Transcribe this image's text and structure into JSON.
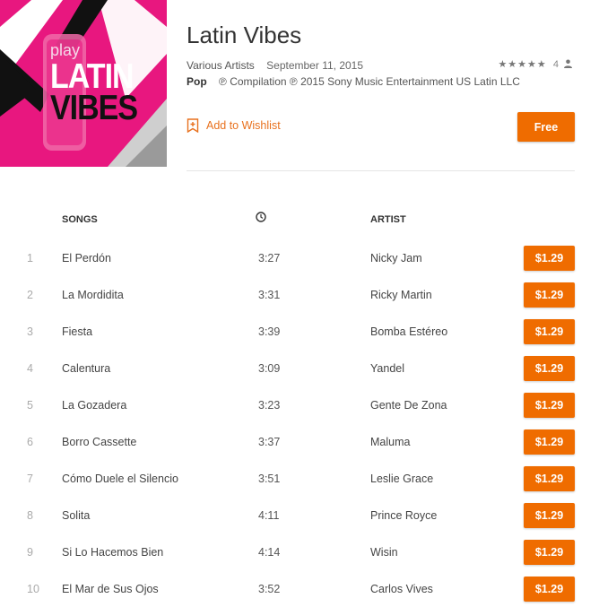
{
  "album": {
    "cover": {
      "play_text": "play",
      "line1": "LATIN",
      "line2": "VIBES",
      "bg_color": "#e8177f"
    },
    "title": "Latin Vibes",
    "artist": "Various Artists",
    "release_date": "September 11, 2015",
    "rating": {
      "stars": "★★★★★",
      "value": 5,
      "count": "4",
      "icon": "user-icon"
    },
    "genre": "Pop",
    "copyright": "℗ Compilation ℗ 2015 Sony Music Entertainment US Latin LLC"
  },
  "actions": {
    "wishlist_label": "Add to Wishlist",
    "wishlist_icon": "bookmark-plus-icon",
    "free_label": "Free",
    "accent_color": "#ef6c00"
  },
  "table": {
    "headers": {
      "songs": "SONGS",
      "duration_icon": "clock-icon",
      "artist": "ARTIST"
    },
    "rows": [
      {
        "num": "1",
        "song": "El Perdón",
        "duration": "3:27",
        "artist": "Nicky Jam",
        "price": "$1.29"
      },
      {
        "num": "2",
        "song": "La Mordidita",
        "duration": "3:31",
        "artist": "Ricky Martin",
        "price": "$1.29"
      },
      {
        "num": "3",
        "song": "Fiesta",
        "duration": "3:39",
        "artist": "Bomba Estéreo",
        "price": "$1.29"
      },
      {
        "num": "4",
        "song": "Calentura",
        "duration": "3:09",
        "artist": "Yandel",
        "price": "$1.29"
      },
      {
        "num": "5",
        "song": "La Gozadera",
        "duration": "3:23",
        "artist": "Gente De Zona",
        "price": "$1.29"
      },
      {
        "num": "6",
        "song": "Borro Cassette",
        "duration": "3:37",
        "artist": "Maluma",
        "price": "$1.29"
      },
      {
        "num": "7",
        "song": "Cómo Duele el Silencio",
        "duration": "3:51",
        "artist": "Leslie Grace",
        "price": "$1.29"
      },
      {
        "num": "8",
        "song": "Solita",
        "duration": "4:11",
        "artist": "Prince Royce",
        "price": "$1.29"
      },
      {
        "num": "9",
        "song": "Si Lo Hacemos Bien",
        "duration": "4:14",
        "artist": "Wisin",
        "price": "$1.29"
      },
      {
        "num": "10",
        "song": "El Mar de Sus Ojos",
        "duration": "3:52",
        "artist": "Carlos Vives",
        "price": "$1.29"
      }
    ]
  }
}
